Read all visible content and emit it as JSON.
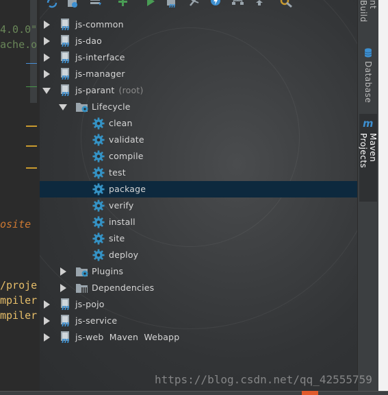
{
  "editor": {
    "lines": [
      {
        "text": "4.0.0\"",
        "class": "green"
      },
      {
        "text": "ache.o",
        "class": "green"
      },
      {
        "text": "osite",
        "class": "ital"
      },
      {
        "text": "/proje",
        "class": "yellow"
      },
      {
        "text": "mpiler",
        "class": "yellow"
      },
      {
        "text": "mpiler",
        "class": "yellow"
      }
    ]
  },
  "toolbar": {
    "icons": [
      "reimport-icon",
      "generate-sources-icon",
      "download-icon",
      "add-icon",
      "run-icon",
      "execute-goal-icon",
      "toggle-offline-icon",
      "skip-tests-icon",
      "show-dependencies-icon",
      "collapse-all-icon",
      "settings-icon"
    ]
  },
  "tree": {
    "nodes": [
      {
        "label": "js-common",
        "suffix": "",
        "type": "module",
        "expanded": false
      },
      {
        "label": "js-dao",
        "suffix": "",
        "type": "module",
        "expanded": false
      },
      {
        "label": "js-interface",
        "suffix": "",
        "type": "module",
        "expanded": false
      },
      {
        "label": "js-manager",
        "suffix": "",
        "type": "module",
        "expanded": false
      },
      {
        "label": "js-parant",
        "suffix": "(root)",
        "type": "module",
        "expanded": true
      },
      {
        "label": "Lifecycle",
        "suffix": "",
        "type": "lifecycle-folder",
        "expanded": true
      },
      {
        "label": "clean",
        "suffix": "",
        "type": "goal"
      },
      {
        "label": "validate",
        "suffix": "",
        "type": "goal"
      },
      {
        "label": "compile",
        "suffix": "",
        "type": "goal"
      },
      {
        "label": "test",
        "suffix": "",
        "type": "goal"
      },
      {
        "label": "package",
        "suffix": "",
        "type": "goal",
        "selected": true
      },
      {
        "label": "verify",
        "suffix": "",
        "type": "goal"
      },
      {
        "label": "install",
        "suffix": "",
        "type": "goal"
      },
      {
        "label": "site",
        "suffix": "",
        "type": "goal"
      },
      {
        "label": "deploy",
        "suffix": "",
        "type": "goal"
      },
      {
        "label": "Plugins",
        "suffix": "",
        "type": "plugins-folder",
        "expanded": false
      },
      {
        "label": "Dependencies",
        "suffix": "",
        "type": "dependencies-folder",
        "expanded": false
      },
      {
        "label": "js-pojo",
        "suffix": "",
        "type": "module",
        "expanded": false
      },
      {
        "label": "js-service",
        "suffix": "",
        "type": "module",
        "expanded": false
      },
      {
        "label": "js-web Maven Webapp",
        "suffix": "",
        "type": "module",
        "expanded": false
      }
    ]
  },
  "strip": {
    "tabs": [
      {
        "label": "Ant Build",
        "visible_text": "nt Build",
        "active": false
      },
      {
        "label": "Database",
        "visible_text": "Database",
        "active": false
      },
      {
        "label": "Maven Projects",
        "visible_text": "Maven Projects",
        "active": true
      }
    ]
  },
  "watermark": "https://blog.csdn.net/qq_42555759",
  "colors": {
    "selection": "#0d293e",
    "goal_gear": "#3592c4",
    "run_green": "#499c54",
    "maven_blue": "#3d8fd0"
  }
}
